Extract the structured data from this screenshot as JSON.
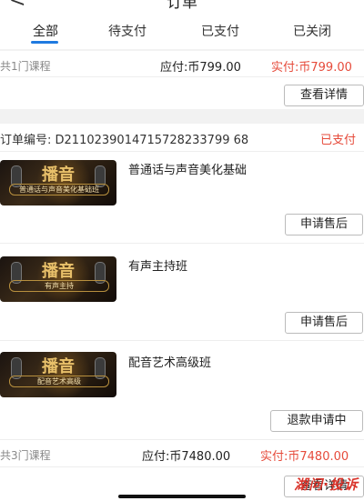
{
  "header": {
    "title": "订单",
    "tabs": [
      "全部",
      "待支付",
      "已支付",
      "已关闭"
    ]
  },
  "order1_summary": {
    "count": "共1门课程",
    "payable": "应付:币799.00",
    "paid": "实付:币799.00",
    "button": "查看详情"
  },
  "order2": {
    "order_no": "订单编号: D2110239014715728233799 68",
    "status": "已支付",
    "items": [
      {
        "name": "普通话与声音美化基础",
        "img_big": "播音",
        "img_sub": "普通话与声音美化基础班",
        "button": "申请售后"
      },
      {
        "name": "有声主持班",
        "img_big": "播音",
        "img_sub": "有声主持",
        "button": "申请售后"
      },
      {
        "name": "配音艺术高级班",
        "img_big": "播音",
        "img_sub": "配音艺术高级",
        "button": "退款申请中"
      }
    ],
    "count": "共3门课程",
    "payable": "应付:币7480.00",
    "paid": "实付:币7480.00",
    "button": "查看详情"
  },
  "watermark": "湖问·投诉",
  "colors": {
    "accent": "#1f7ae0",
    "paid_red": "#e64b3b"
  }
}
